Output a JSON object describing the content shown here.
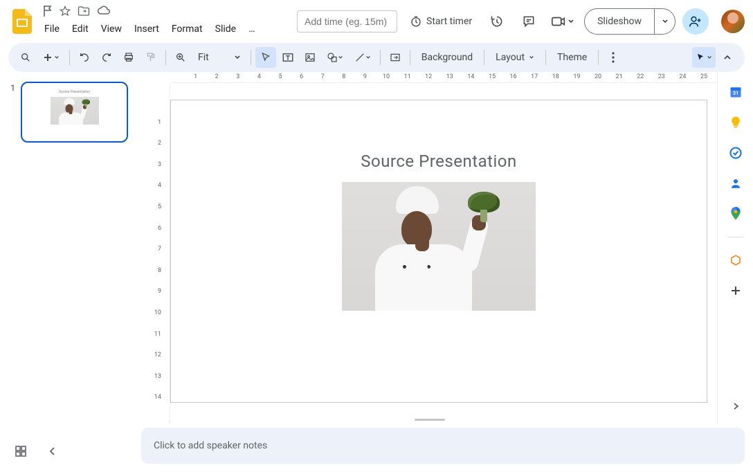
{
  "header": {
    "menus": [
      "File",
      "Edit",
      "View",
      "Insert",
      "Format",
      "Slide",
      "…"
    ],
    "time_placeholder": "Add time (eg. 15m)",
    "start_timer": "Start timer",
    "slideshow": "Slideshow"
  },
  "toolbar": {
    "zoom_label": "Fit",
    "background": "Background",
    "layout": "Layout",
    "theme": "Theme"
  },
  "filmstrip": {
    "slides": [
      {
        "number": "1",
        "title": "Source Presentation"
      }
    ]
  },
  "slide": {
    "title": "Source Presentation"
  },
  "notes": {
    "placeholder": "Click to add speaker notes"
  },
  "ruler_h": [
    1,
    2,
    3,
    4,
    5,
    6,
    7,
    8,
    9,
    10,
    11,
    12,
    13,
    14,
    15,
    16,
    17,
    18,
    19,
    20,
    21,
    22,
    23,
    24,
    25
  ],
  "ruler_v": [
    1,
    2,
    3,
    4,
    5,
    6,
    7,
    8,
    9,
    10,
    11,
    12,
    13,
    14
  ]
}
